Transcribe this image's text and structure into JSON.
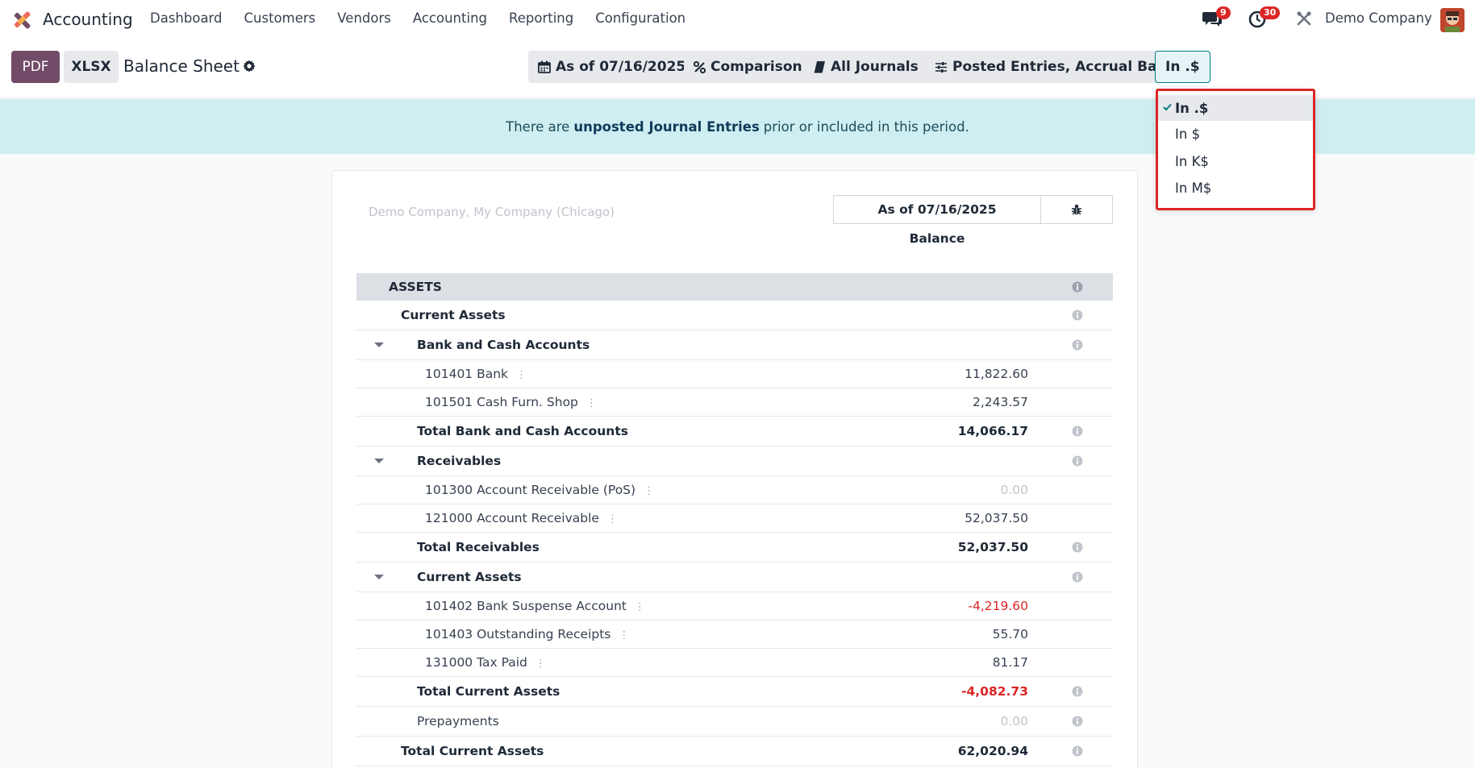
{
  "navbar": {
    "app_name": "Accounting",
    "menu": [
      "Dashboard",
      "Customers",
      "Vendors",
      "Accounting",
      "Reporting",
      "Configuration"
    ],
    "messages_count": "9",
    "activities_count": "30",
    "company": "Demo Company"
  },
  "controls": {
    "pdf_label": "PDF",
    "xlsx_label": "XLSX",
    "report_title": "Balance Sheet",
    "date_filter": "As of 07/16/2025",
    "comparison": "Comparison",
    "journals": "All Journals",
    "entries": "Posted Entries, Accrual Basis",
    "unit": "In .$"
  },
  "alert": {
    "before": "There are",
    "link": "unposted Journal Entries",
    "after": "prior or included in this period."
  },
  "report": {
    "company_line": "Demo Company, My Company (Chicago)",
    "column_date": "As of 07/16/2025",
    "column_label": "Balance",
    "rows": [
      {
        "label": "ASSETS",
        "value": ""
      },
      {
        "label": "Current Assets",
        "value": ""
      },
      {
        "label": "Bank and Cash Accounts",
        "value": ""
      },
      {
        "label": "101401 Bank",
        "value": "11,822.60"
      },
      {
        "label": "101501 Cash Furn. Shop",
        "value": "2,243.57"
      },
      {
        "label": "Total Bank and Cash Accounts",
        "value": "14,066.17"
      },
      {
        "label": "Receivables",
        "value": ""
      },
      {
        "label": "101300 Account Receivable (PoS)",
        "value": "0.00"
      },
      {
        "label": "121000 Account Receivable",
        "value": "52,037.50"
      },
      {
        "label": "Total Receivables",
        "value": "52,037.50"
      },
      {
        "label": "Current Assets",
        "value": ""
      },
      {
        "label": "101402 Bank Suspense Account",
        "value": "-4,219.60"
      },
      {
        "label": "101403 Outstanding Receipts",
        "value": "55.70"
      },
      {
        "label": "131000 Tax Paid",
        "value": "81.17"
      },
      {
        "label": "Total Current Assets",
        "value": "-4,082.73"
      },
      {
        "label": "Prepayments",
        "value": "0.00"
      },
      {
        "label": "Total Current Assets",
        "value": "62,020.94"
      }
    ]
  },
  "unit_dropdown": {
    "options": [
      "In .$",
      "In $",
      "In K$",
      "In M$"
    ],
    "selected": "In .$"
  }
}
